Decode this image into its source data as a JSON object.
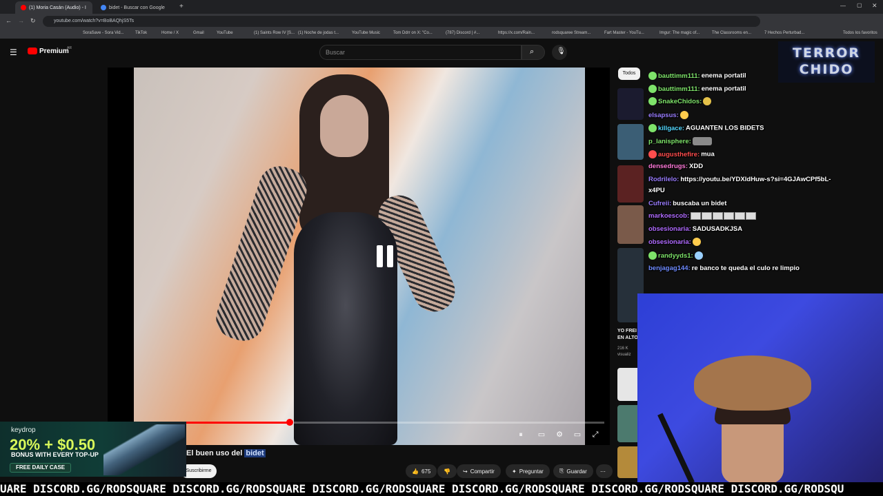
{
  "browser": {
    "tabs": [
      {
        "label": "(1) Moria Casán (Audio) - I",
        "active": true
      },
      {
        "label": "bidet - Buscar con Google",
        "active": false
      }
    ],
    "url": "youtube.com/watch?v=BoBAQhjS5Ts",
    "bookmarks": [
      "SoraSave - Sora Vid...",
      "TikTok",
      "Home / X",
      "Gmail",
      "YouTube",
      "(1) Saints Row IV [S...",
      "(1) Noche de jodas t...",
      "YouTube Music",
      "Tom Ddrr on X: \"Co...",
      "(787) Discord | #...",
      "https://x.com/Rain...",
      "rodsquaree Stream...",
      "Fart Master - YouTu...",
      "Imgur: The magic of...",
      "The Classrooms en...",
      "7 Hechos Perturbad..."
    ],
    "bookmarks_all": "Todos los favoritos"
  },
  "youtube": {
    "logo_label": "Premium",
    "logo_region": "AR",
    "search_placeholder": "Buscar",
    "video_title_prefix": "El buen uso del ",
    "video_title_highlight": "bidet",
    "subscribe_label": "Suscribirme",
    "like_count": "675",
    "share_label": "Compartir",
    "ask_label": "Preguntar",
    "save_label": "Guardar",
    "progress": 0.36,
    "chip_all": "Todos",
    "rec_title": "YO FREI EN ALTO",
    "rec_views": "216 K visualiz"
  },
  "chat": [
    {
      "user": "bauttimm111:",
      "text": "enema portatil",
      "color": "#7ee36a"
    },
    {
      "user": "bauttimm111:",
      "text": "enema portatil",
      "color": "#7ee36a"
    },
    {
      "user": "SnakeChidos:",
      "text": "",
      "color": "#7ee36a"
    },
    {
      "user": "elsapsus:",
      "text": "",
      "color": "#9a7dff"
    },
    {
      "user": "killgace:",
      "text": "AGUANTEN LOS BIDETS",
      "color": "#54d7ff"
    },
    {
      "user": "p_lanisphere:",
      "text": "",
      "color": "#7ee36a"
    },
    {
      "user": "augusthefire:",
      "text": "mua",
      "color": "#ff4d4d"
    },
    {
      "user": "densedrugs:",
      "text": "XDD",
      "color": "#ff7ad9"
    },
    {
      "user": "Rodrilelo:",
      "text": "https://youtu.be/YDXldHuw-s?si=4GJAwCPf5bL-",
      "color": "#9a7dff"
    },
    {
      "user": "",
      "text": "x4PU",
      "color": "#ffffff"
    },
    {
      "user": "Cufreii:",
      "text": "buscaba un bidet",
      "color": "#9a7dff"
    },
    {
      "user": "markoescob:",
      "text": "",
      "color": "#b06bff"
    },
    {
      "user": "obsesionaria:",
      "text": "SADUSADKJSA",
      "color": "#b06bff"
    },
    {
      "user": "obsesionaria:",
      "text": "",
      "color": "#b06bff"
    },
    {
      "user": "randyyds1:",
      "text": "",
      "color": "#7ee36a"
    },
    {
      "user": "benjagag144:",
      "text": "re banco te queda el culo re limpio",
      "color": "#6f8bff"
    }
  ],
  "overlay": {
    "logo_line1": "TERROR",
    "logo_line2": "CHIDO",
    "ticker": "UARE  DISCORD.GG/RODSQUARE  DISCORD.GG/RODSQUARE  DISCORD.GG/RODSQUARE  DISCORD.GG/RODSQUARE  DISCORD.GG/RODSQUARE DISCORD.GG/RODSQU"
  },
  "ad": {
    "brand": "keydrop",
    "headline": "20% + $0.50",
    "subline": "BONUS WITH EVERY TOP-UP",
    "cta": "FREE DAILY CASE"
  }
}
